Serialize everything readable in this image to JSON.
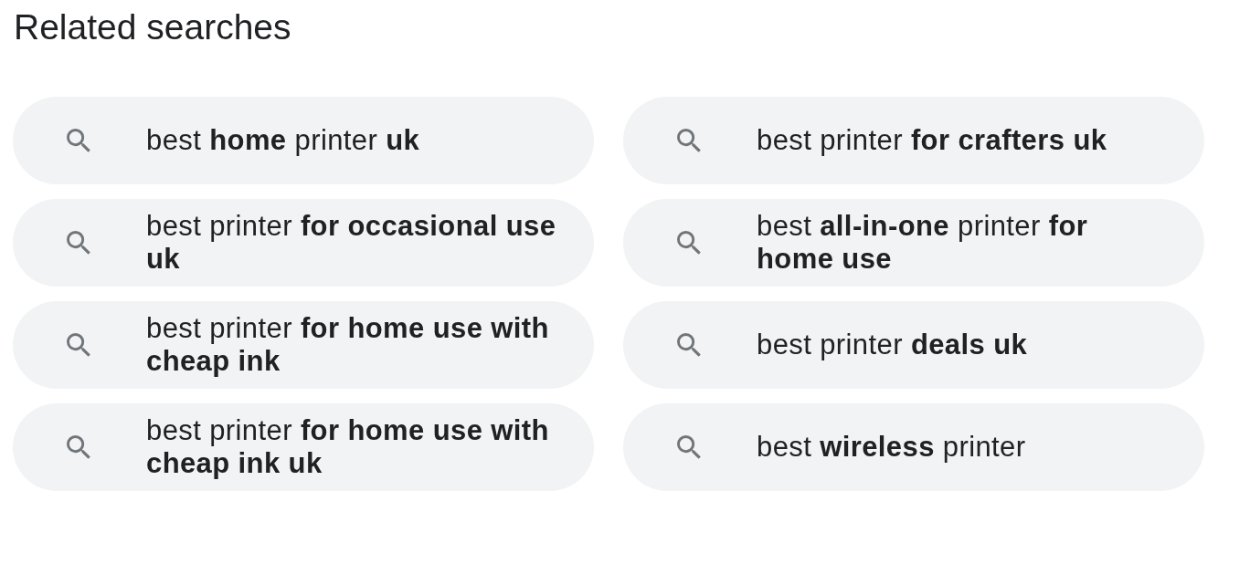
{
  "heading": "Related searches",
  "searches": [
    {
      "query": "best **home** printer **uk**"
    },
    {
      "query": "best printer **for crafters uk**"
    },
    {
      "query": "best printer **for occasional use uk**"
    },
    {
      "query": "best **all-in-one** printer **for home use**"
    },
    {
      "query": "best printer **for home use with cheap ink**"
    },
    {
      "query": "best printer **deals uk**"
    },
    {
      "query": "best printer **for home use with cheap ink uk**"
    },
    {
      "query": "best **wireless** printer"
    }
  ]
}
